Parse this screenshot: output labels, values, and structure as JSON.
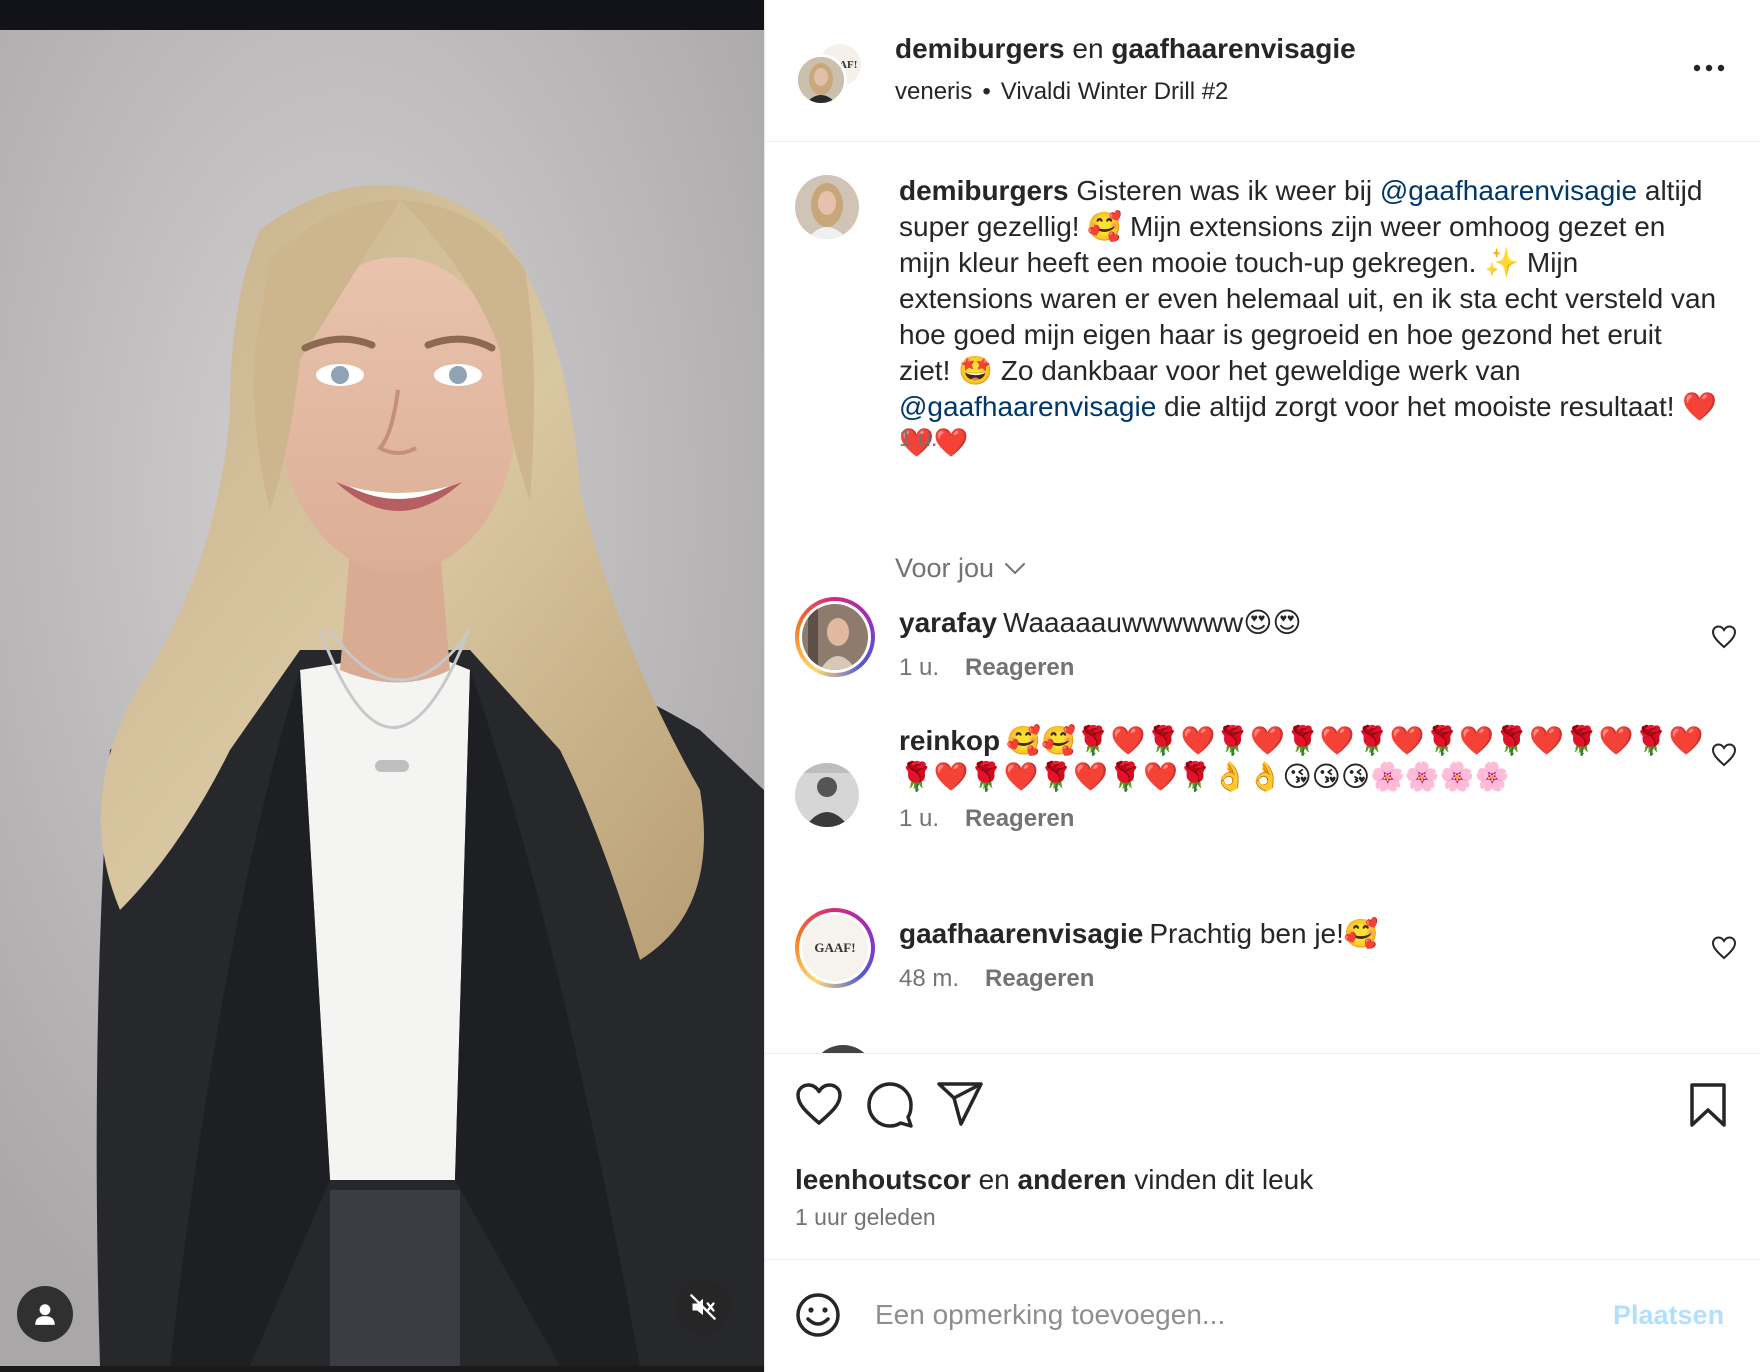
{
  "header": {
    "author": "demiburgers",
    "joiner": "en",
    "collaborator": "gaafhaarenvisagie",
    "collaborator_logo_text": "GAAF!",
    "audio_artist": "veneris",
    "separator": "•",
    "audio_title": "Vivaldi Winter Drill #2"
  },
  "caption": {
    "user": "demiburgers",
    "part1": "Gisteren was ik weer bij",
    "mention1": "@gaafhaarenvisagie",
    "part2": "altijd super gezellig! 🥰 Mijn extensions zijn weer omhoog gezet en mijn kleur heeft een mooie touch-up gekregen. ✨ Mijn extensions waren er even helemaal uit, en ik sta echt versteld van hoe goed mijn eigen haar is gegroeid en hoe gezond het eruit ziet! 🤩 Zo dankbaar voor het geweldige werk van",
    "mention2": "@gaafhaarenvisagie",
    "part3": "die altijd zorgt voor het mooiste resultaat! ❤️❤️❤️",
    "time": "1 u."
  },
  "filter": {
    "label": "Voor jou"
  },
  "comments": [
    {
      "user": "yarafay",
      "text": "Waaaaauwwwwww😍😍",
      "time": "1 u.",
      "reply": "Reageren"
    },
    {
      "user": "reinkop",
      "text": "🥰🥰🌹❤️🌹❤️🌹❤️🌹❤️🌹❤️🌹❤️🌹❤️🌹❤️🌹❤️🌹❤️🌹❤️🌹❤️🌹❤️🌹👌👌😘😘😘🌸🌸🌸🌸",
      "time": "1 u.",
      "reply": "Reageren"
    },
    {
      "user": "gaafhaarenvisagie",
      "text": "Prachtig ben je!🥰",
      "time": "48 m.",
      "reply": "Reageren",
      "logo_text": "GAAF!"
    }
  ],
  "likes": {
    "user": "leenhoutscor",
    "joiner": "en",
    "others": "anderen",
    "suffix": "vinden dit leuk"
  },
  "posted": "1 uur geleden",
  "add_comment": {
    "placeholder": "Een opmerking toevoegen...",
    "post_label": "Plaatsen"
  },
  "colors": {
    "mention": "#00376b",
    "secondary_text": "#737373",
    "post_button_disabled": "#b2dffc"
  }
}
